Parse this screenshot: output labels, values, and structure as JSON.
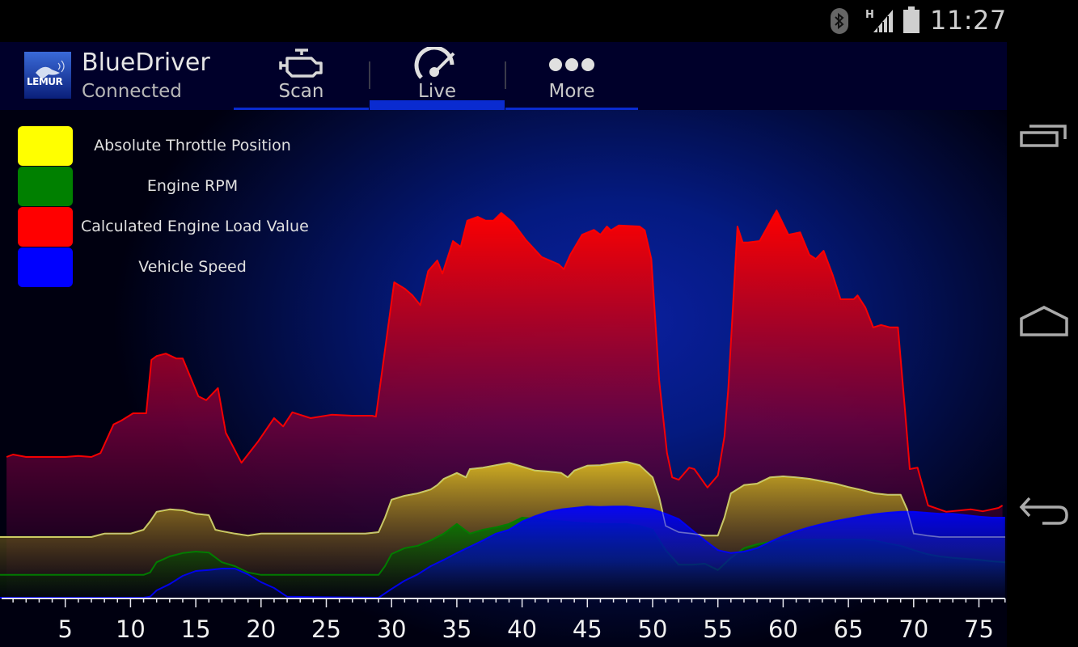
{
  "status_bar": {
    "time": "11:27",
    "network_label": "H",
    "icons": [
      "bluetooth-icon",
      "signal-icon",
      "battery-icon"
    ]
  },
  "app_bar": {
    "logo_text": "LEMUR",
    "title": "BlueDriver",
    "subtitle": "Connected",
    "tabs": [
      {
        "label": "Scan",
        "icon": "check-engine-icon",
        "active": false
      },
      {
        "label": "Live",
        "icon": "speedometer-icon",
        "active": true
      },
      {
        "label": "More",
        "icon": "more-dots-icon",
        "active": false
      }
    ]
  },
  "nav_bar": {
    "buttons": [
      {
        "name": "recent-apps",
        "icon": "recent-apps-icon"
      },
      {
        "name": "home",
        "icon": "home-icon"
      },
      {
        "name": "back",
        "icon": "back-icon"
      }
    ]
  },
  "colors": {
    "accent": "#0a2bd0",
    "app_bar_bg": "#00002a",
    "throttle": "#ffff00",
    "rpm": "#008000",
    "load": "#ff0000",
    "speed": "#0000ff"
  },
  "chart_data": {
    "type": "area",
    "title": "",
    "xlabel": "",
    "ylabel": "",
    "xlim": [
      0,
      77
    ],
    "ylim": [
      0,
      100
    ],
    "y_units": "relative (no y-axis shown)",
    "grid": false,
    "legend_position": "top-left",
    "x_ticks": [
      5,
      10,
      15,
      20,
      25,
      30,
      35,
      40,
      45,
      50,
      55,
      60,
      65,
      70,
      75
    ],
    "minor_tick_step": 1,
    "series": [
      {
        "name": "Calculated Engine Load Value",
        "color": "#ff0000",
        "points": [
          [
            0.5,
            29
          ],
          [
            1,
            29.5
          ],
          [
            2,
            29
          ],
          [
            3,
            29
          ],
          [
            4,
            29
          ],
          [
            5,
            29
          ],
          [
            6,
            29.2
          ],
          [
            7,
            29
          ],
          [
            7.7,
            29.8
          ],
          [
            8.7,
            35.7
          ],
          [
            9.3,
            36.5
          ],
          [
            10.2,
            38
          ],
          [
            11.2,
            38
          ],
          [
            11.6,
            49
          ],
          [
            12,
            49.8
          ],
          [
            12.7,
            50.3
          ],
          [
            13.5,
            49.3
          ],
          [
            14,
            49.3
          ],
          [
            15.2,
            41.5
          ],
          [
            15.8,
            40.7
          ],
          [
            16.7,
            43.2
          ],
          [
            17.3,
            34
          ],
          [
            18.5,
            27.8
          ],
          [
            19.8,
            32.3
          ],
          [
            21,
            37
          ],
          [
            21.7,
            35.3
          ],
          [
            22.4,
            38.2
          ],
          [
            23.8,
            37
          ],
          [
            25.4,
            37.7
          ],
          [
            27,
            37.5
          ],
          [
            28.5,
            37.5
          ],
          [
            28.8,
            37.3
          ],
          [
            30.2,
            65
          ],
          [
            31,
            63.7
          ],
          [
            31.6,
            62.3
          ],
          [
            32.2,
            60.3
          ],
          [
            32.8,
            67.3
          ],
          [
            33.5,
            69.5
          ],
          [
            33.9,
            66.8
          ],
          [
            34.7,
            73.5
          ],
          [
            35.3,
            72.3
          ],
          [
            35.8,
            77.7
          ],
          [
            36.6,
            78.5
          ],
          [
            37.2,
            77.7
          ],
          [
            37.8,
            77.7
          ],
          [
            38.4,
            79.3
          ],
          [
            39.3,
            77.3
          ],
          [
            40.3,
            73.7
          ],
          [
            41.5,
            70.2
          ],
          [
            42.8,
            68.7
          ],
          [
            43.2,
            67.7
          ],
          [
            43.7,
            70.7
          ],
          [
            44.6,
            74.8
          ],
          [
            45.5,
            75.8
          ],
          [
            46,
            74.8
          ],
          [
            46.5,
            76.5
          ],
          [
            46.8,
            75.7
          ],
          [
            47.4,
            76.7
          ],
          [
            49,
            76.5
          ],
          [
            49.4,
            75.7
          ],
          [
            49.9,
            69.8
          ],
          [
            50.5,
            44.8
          ],
          [
            51.1,
            29.8
          ],
          [
            51.5,
            24.8
          ],
          [
            52,
            24.3
          ],
          [
            52.8,
            26.8
          ],
          [
            53.2,
            26.5
          ],
          [
            54.2,
            22.7
          ],
          [
            55,
            25.2
          ],
          [
            55.5,
            33.2
          ],
          [
            55.8,
            43.2
          ],
          [
            56.5,
            76.5
          ],
          [
            56.9,
            73.2
          ],
          [
            57.3,
            73.2
          ],
          [
            58.2,
            73.5
          ],
          [
            59.5,
            79.8
          ],
          [
            60.4,
            74.8
          ],
          [
            61.3,
            75.3
          ],
          [
            62,
            70.7
          ],
          [
            62.5,
            69.8
          ],
          [
            63.1,
            71.5
          ],
          [
            63.8,
            66.5
          ],
          [
            64.4,
            61.5
          ],
          [
            65.4,
            61.5
          ],
          [
            65.7,
            62.3
          ],
          [
            66.3,
            59.8
          ],
          [
            66.9,
            55.7
          ],
          [
            67.5,
            56.2
          ],
          [
            68.2,
            55.7
          ],
          [
            68.8,
            55.7
          ],
          [
            69.3,
            39.8
          ],
          [
            69.7,
            26.5
          ],
          [
            70.3,
            26.8
          ],
          [
            71.1,
            19
          ],
          [
            72.5,
            17.7
          ],
          [
            74.4,
            18.2
          ],
          [
            75.3,
            17.8
          ],
          [
            76.5,
            18.5
          ],
          [
            76.8,
            19
          ]
        ]
      },
      {
        "name": "Absolute Throttle Position",
        "color": "#ffff00",
        "points": [
          [
            0,
            12.5
          ],
          [
            7,
            12.5
          ],
          [
            8,
            13.2
          ],
          [
            10,
            13.2
          ],
          [
            11,
            14
          ],
          [
            11.5,
            15.7
          ],
          [
            12,
            17.7
          ],
          [
            13,
            18.2
          ],
          [
            14,
            18
          ],
          [
            15,
            17.3
          ],
          [
            16,
            17
          ],
          [
            16.5,
            14
          ],
          [
            17,
            13.7
          ],
          [
            18,
            13.2
          ],
          [
            19,
            12.8
          ],
          [
            20,
            13.2
          ],
          [
            28,
            13.2
          ],
          [
            29,
            13.5
          ],
          [
            29.5,
            16.5
          ],
          [
            30,
            20.2
          ],
          [
            31,
            21
          ],
          [
            32,
            21.5
          ],
          [
            33,
            22.3
          ],
          [
            33.5,
            23.2
          ],
          [
            34,
            24.5
          ],
          [
            35,
            25.7
          ],
          [
            35.7,
            24.8
          ],
          [
            36,
            26.5
          ],
          [
            37,
            26.8
          ],
          [
            38,
            27.3
          ],
          [
            39,
            27.8
          ],
          [
            40,
            27
          ],
          [
            41,
            26.2
          ],
          [
            42,
            26
          ],
          [
            43,
            25.7
          ],
          [
            43.5,
            24.8
          ],
          [
            44,
            26.2
          ],
          [
            45,
            27.2
          ],
          [
            46,
            27.3
          ],
          [
            47,
            27.7
          ],
          [
            48,
            28
          ],
          [
            49,
            27.3
          ],
          [
            50,
            24.8
          ],
          [
            50.5,
            20.7
          ],
          [
            51,
            14.8
          ],
          [
            52,
            13.5
          ],
          [
            53,
            13.2
          ],
          [
            54,
            12.8
          ],
          [
            55,
            12.8
          ],
          [
            55.5,
            16.5
          ],
          [
            56,
            21.5
          ],
          [
            57,
            23.2
          ],
          [
            58,
            23.5
          ],
          [
            59,
            24.8
          ],
          [
            60,
            25
          ],
          [
            61,
            24.8
          ],
          [
            62,
            24.5
          ],
          [
            63,
            24
          ],
          [
            64,
            23.5
          ],
          [
            65,
            22.8
          ],
          [
            66,
            22.2
          ],
          [
            67,
            21.5
          ],
          [
            68,
            21.2
          ],
          [
            69,
            21.2
          ],
          [
            69.5,
            18.2
          ],
          [
            70,
            13.2
          ],
          [
            71,
            12.8
          ],
          [
            72,
            12.5
          ],
          [
            77,
            12.5
          ]
        ]
      },
      {
        "name": "Engine RPM",
        "color": "#008000",
        "points": [
          [
            0,
            4.7
          ],
          [
            11,
            4.7
          ],
          [
            11.5,
            5.2
          ],
          [
            12,
            7.3
          ],
          [
            13,
            8.5
          ],
          [
            14,
            9.2
          ],
          [
            15,
            9.5
          ],
          [
            16,
            9.3
          ],
          [
            17,
            7.3
          ],
          [
            18,
            6.5
          ],
          [
            19,
            5.2
          ],
          [
            20,
            4.7
          ],
          [
            29,
            4.7
          ],
          [
            29.5,
            6.5
          ],
          [
            30,
            9
          ],
          [
            31,
            10.2
          ],
          [
            32,
            10.7
          ],
          [
            33,
            11.8
          ],
          [
            34,
            13.2
          ],
          [
            35,
            15.2
          ],
          [
            36,
            13.2
          ],
          [
            37,
            14
          ],
          [
            38,
            14.5
          ],
          [
            39,
            15.2
          ],
          [
            40,
            16.5
          ],
          [
            42,
            16
          ],
          [
            44,
            15.5
          ],
          [
            46,
            15.2
          ],
          [
            48,
            15.2
          ],
          [
            49,
            14.8
          ],
          [
            50,
            14
          ],
          [
            51,
            9.8
          ],
          [
            52,
            6.8
          ],
          [
            53,
            6.8
          ],
          [
            54,
            7
          ],
          [
            55,
            5.7
          ],
          [
            56,
            8.2
          ],
          [
            57,
            10.2
          ],
          [
            58,
            11
          ],
          [
            59,
            11.5
          ],
          [
            60,
            11.8
          ],
          [
            61,
            12
          ],
          [
            66,
            12
          ],
          [
            67,
            11.8
          ],
          [
            68,
            11.2
          ],
          [
            69,
            10.7
          ],
          [
            70,
            9.8
          ],
          [
            71,
            9
          ],
          [
            72,
            8.5
          ],
          [
            73,
            8.2
          ],
          [
            74,
            8
          ],
          [
            75,
            7.8
          ],
          [
            76,
            7.5
          ],
          [
            77,
            7.3
          ]
        ]
      },
      {
        "name": "Vehicle Speed",
        "color": "#0000ff",
        "points": [
          [
            0,
            0
          ],
          [
            11,
            0
          ],
          [
            11.5,
            0.2
          ],
          [
            12,
            1.5
          ],
          [
            13,
            2.8
          ],
          [
            14,
            4.5
          ],
          [
            15,
            5.5
          ],
          [
            16,
            5.7
          ],
          [
            17,
            6
          ],
          [
            18,
            6
          ],
          [
            19,
            4.8
          ],
          [
            20,
            3.2
          ],
          [
            21,
            2
          ],
          [
            22,
            0.2
          ],
          [
            29,
            0
          ],
          [
            30,
            1.8
          ],
          [
            31,
            3.5
          ],
          [
            32,
            4.8
          ],
          [
            33,
            6.5
          ],
          [
            34,
            7.8
          ],
          [
            35,
            9.2
          ],
          [
            36,
            10.5
          ],
          [
            37,
            11.8
          ],
          [
            38,
            13.2
          ],
          [
            39,
            14
          ],
          [
            40,
            15.7
          ],
          [
            41,
            16.8
          ],
          [
            42,
            17.7
          ],
          [
            43,
            18.2
          ],
          [
            44,
            18.5
          ],
          [
            45,
            18.8
          ],
          [
            46,
            18.7
          ],
          [
            47,
            18.8
          ],
          [
            48,
            18.8
          ],
          [
            49,
            18.5
          ],
          [
            50,
            18.2
          ],
          [
            51,
            17.3
          ],
          [
            52,
            16.2
          ],
          [
            53,
            14
          ],
          [
            54,
            11.8
          ],
          [
            55,
            9.8
          ],
          [
            56,
            9.2
          ],
          [
            57,
            9.5
          ],
          [
            58,
            10.2
          ],
          [
            59,
            11.5
          ],
          [
            60,
            12.7
          ],
          [
            61,
            13.7
          ],
          [
            62,
            14.5
          ],
          [
            63,
            15.2
          ],
          [
            64,
            15.8
          ],
          [
            65,
            16.3
          ],
          [
            66,
            16.8
          ],
          [
            67,
            17.2
          ],
          [
            68,
            17.5
          ],
          [
            69,
            17.7
          ],
          [
            70,
            17.7
          ],
          [
            71,
            17.5
          ],
          [
            72,
            17.3
          ],
          [
            73,
            17.3
          ],
          [
            74,
            17
          ],
          [
            75,
            16.7
          ],
          [
            76,
            16.5
          ],
          [
            77,
            16.5
          ]
        ]
      }
    ]
  }
}
